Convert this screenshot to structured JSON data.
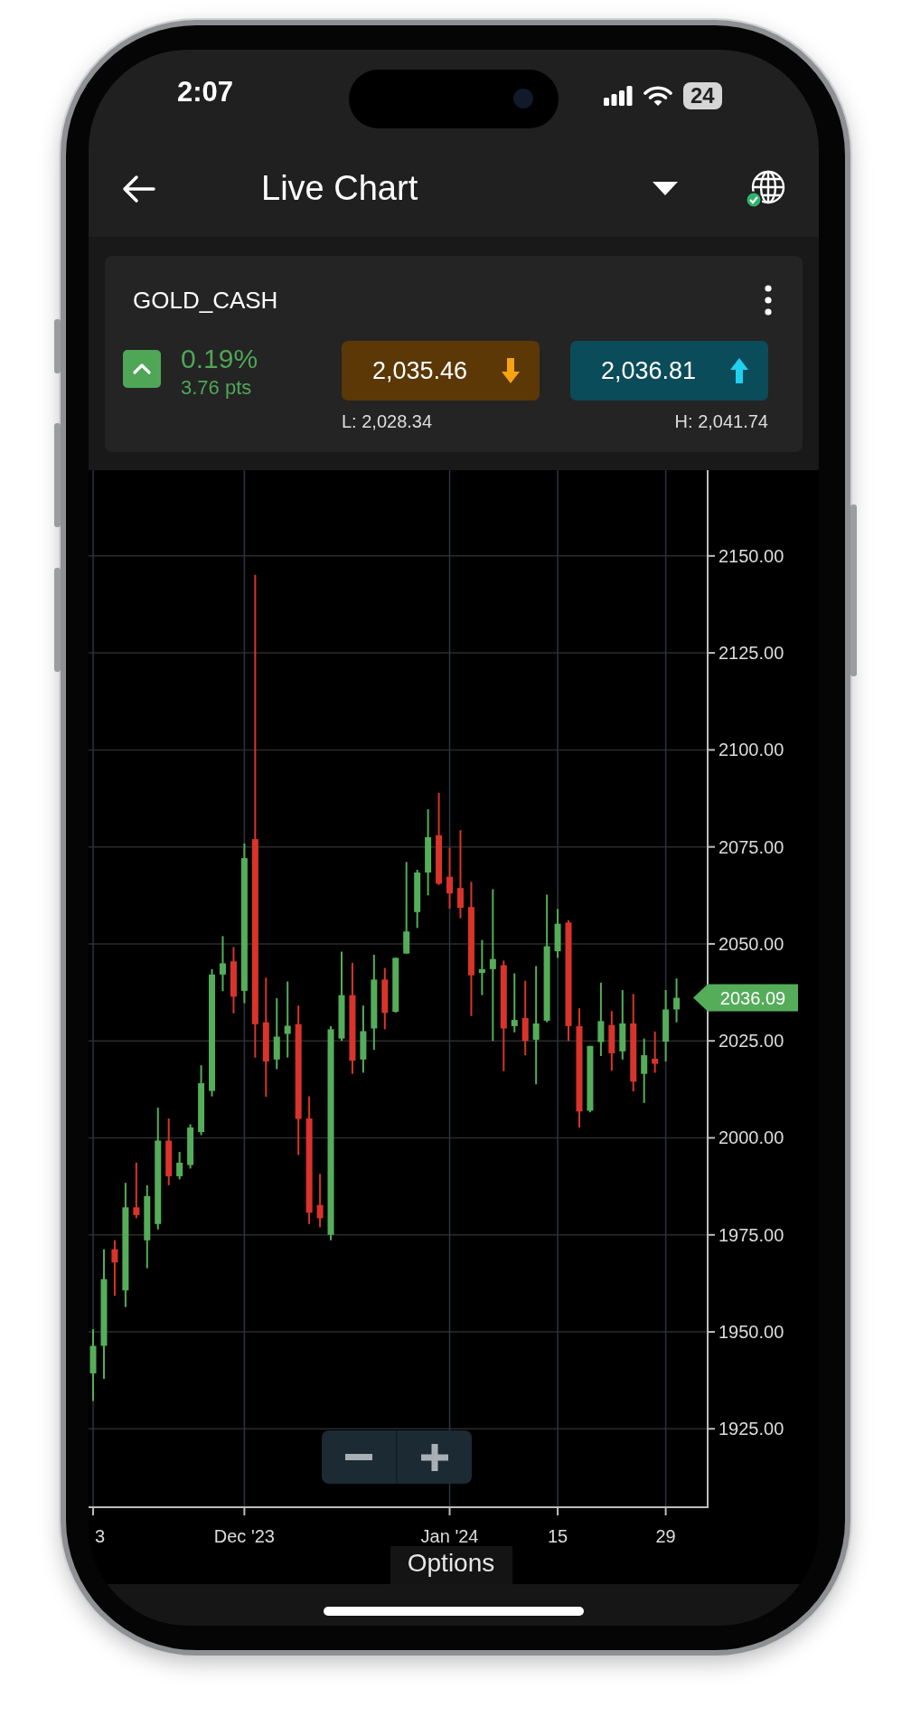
{
  "status_bar": {
    "time": "2:07",
    "battery": "24"
  },
  "app_bar": {
    "title": "Live Chart"
  },
  "instrument": {
    "symbol": "GOLD_CASH",
    "up": true,
    "change_percent": "0.19%",
    "change_points": "3.76 pts",
    "sell_price": "2,035.46",
    "buy_price": "2,036.81",
    "low": "L: 2,028.34",
    "high": "H: 2,041.74"
  },
  "chart": {
    "chart_data": {
      "type": "candlestick",
      "grid": true,
      "ylim": [
        1904.8,
        2172.1
      ],
      "yticks": [
        {
          "value": 2150,
          "label": "2150.00"
        },
        {
          "value": 2125,
          "label": "2125.00"
        },
        {
          "value": 2100,
          "label": "2100.00"
        },
        {
          "value": 2075,
          "label": "2075.00"
        },
        {
          "value": 2050,
          "label": "2050.00"
        },
        {
          "value": 2025,
          "label": "2025.00"
        },
        {
          "value": 2000,
          "label": "2000.00"
        },
        {
          "value": 1975,
          "label": "1975.00"
        },
        {
          "value": 1950,
          "label": "1950.00"
        },
        {
          "value": 1925,
          "label": "1925.00"
        }
      ],
      "categories": [
        "3",
        null,
        null,
        null,
        null,
        null,
        null,
        null,
        null,
        null,
        null,
        null,
        null,
        null,
        "Dec '23",
        null,
        null,
        null,
        null,
        null,
        null,
        null,
        null,
        null,
        null,
        null,
        null,
        null,
        null,
        null,
        null,
        null,
        null,
        "Jan '24",
        null,
        null,
        null,
        null,
        null,
        null,
        null,
        null,
        null,
        "15",
        null,
        null,
        null,
        null,
        null,
        null,
        null,
        null,
        null,
        "29",
        null
      ],
      "ohlc": [
        [
          1939.3,
          1950.7,
          1932.2,
          1946.4
        ],
        [
          1946.4,
          1971.3,
          1937.9,
          1963.6
        ],
        [
          1971.3,
          1973.6,
          1959.3,
          1967.9
        ],
        [
          1960.7,
          1988.4,
          1956.4,
          1982.1
        ],
        [
          1982.1,
          1993.6,
          1979.3,
          1980.1
        ],
        [
          1973.6,
          1987.8,
          1966.4,
          1985.0
        ],
        [
          1977.8,
          2007.8,
          1976.4,
          1999.3
        ],
        [
          1999.3,
          2005.0,
          1987.8,
          1990.1
        ],
        [
          1990.1,
          1996.4,
          1989.3,
          1993.6
        ],
        [
          1993.0,
          2003.5,
          1992.1,
          2002.7
        ],
        [
          2001.5,
          2018.7,
          2000.7,
          2014.1
        ],
        [
          2012.1,
          2043.5,
          2010.7,
          2042.1
        ],
        [
          2042.1,
          2052.0,
          2037.8,
          2045.0
        ],
        [
          2045.5,
          2049.2,
          2032.1,
          2036.4
        ],
        [
          2037.9,
          2075.9,
          2034.7,
          2072.1
        ],
        [
          2077.0,
          2145.1,
          2020.7,
          2029.3
        ],
        [
          2029.8,
          2041.3,
          2010.6,
          2019.7
        ],
        [
          2020.2,
          2036.0,
          2017.7,
          2026.1
        ],
        [
          2026.8,
          2040.3,
          2020.7,
          2028.9
        ],
        [
          2029.3,
          2034.1,
          1995.6,
          2004.9
        ],
        [
          2005.0,
          2010.7,
          1977.8,
          1980.7
        ],
        [
          1982.7,
          1990.7,
          1977.0,
          1979.3
        ],
        [
          1975.0,
          2028.8,
          1973.6,
          2028.0
        ],
        [
          2025.6,
          2048.0,
          2025.0,
          2036.8
        ],
        [
          2036.8,
          2045.1,
          2016.5,
          2019.9
        ],
        [
          2020.2,
          2034.1,
          2016.8,
          2027.5
        ],
        [
          2028.2,
          2047.2,
          2022.7,
          2040.8
        ],
        [
          2040.8,
          2043.8,
          2028.0,
          2032.2
        ],
        [
          2032.5,
          2046.4,
          2032.3,
          2046.4
        ],
        [
          2047.5,
          2071.1,
          2047.5,
          2053.2
        ],
        [
          2058.2,
          2069.1,
          2054.1,
          2068.4
        ],
        [
          2068.4,
          2084.7,
          2062.5,
          2077.5
        ],
        [
          2078.0,
          2088.9,
          2065.2,
          2065.5
        ],
        [
          2067.3,
          2074.8,
          2059.1,
          2063.0
        ],
        [
          2064.4,
          2079.3,
          2056.6,
          2059.3
        ],
        [
          2059.5,
          2066.0,
          2031.4,
          2041.9
        ],
        [
          2042.5,
          2051.0,
          2036.8,
          2043.5
        ],
        [
          2043.5,
          2064.1,
          2025.0,
          2046.1
        ],
        [
          2044.5,
          2045.7,
          2017.2,
          2028.2
        ],
        [
          2028.8,
          2042.4,
          2027.2,
          2030.4
        ],
        [
          2030.9,
          2040.5,
          2021.3,
          2025.0
        ],
        [
          2025.3,
          2044.3,
          2013.8,
          2029.5
        ],
        [
          2030.2,
          2062.7,
          2029.8,
          2049.4
        ],
        [
          2048.1,
          2059.0,
          2046.4,
          2055.2
        ],
        [
          2055.5,
          2056.1,
          2025.0,
          2028.8
        ],
        [
          2028.8,
          2033.4,
          2002.7,
          2006.8
        ],
        [
          2007.0,
          2023.7,
          2006.6,
          2023.7
        ],
        [
          2024.7,
          2040.0,
          2021.1,
          2030.1
        ],
        [
          2029.1,
          2032.7,
          2017.3,
          2021.8
        ],
        [
          2022.3,
          2038.1,
          2020.2,
          2029.5
        ],
        [
          2029.5,
          2037.1,
          2012.0,
          2014.5
        ],
        [
          2016.5,
          2025.6,
          2009.0,
          2021.3
        ],
        [
          2020.4,
          2027.4,
          2016.8,
          2019.1
        ],
        [
          2024.8,
          2038.1,
          2019.7,
          2033.1
        ],
        [
          2033.1,
          2041.1,
          2029.8,
          2036.1
        ]
      ],
      "annotations": [
        "2036.09"
      ]
    }
  },
  "bottom_tab": {
    "label": "Options"
  }
}
